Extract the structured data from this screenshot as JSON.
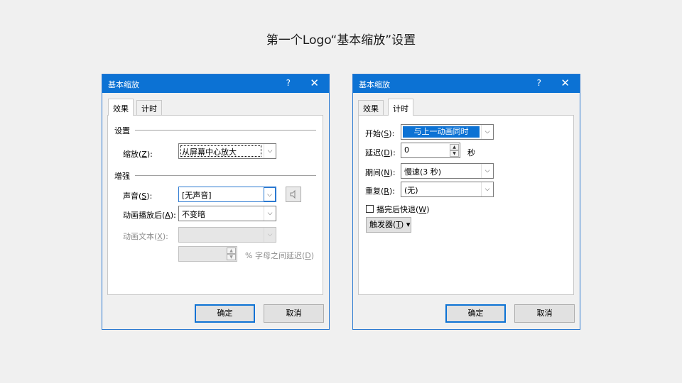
{
  "slide": {
    "title": "第一个Logo“基本缩放”设置"
  },
  "dialog_left": {
    "title": "基本缩放",
    "help": "?",
    "close": "✕",
    "tabs": [
      "效果",
      "计时"
    ],
    "section_settings": "设置",
    "zoom": {
      "label_pre": "缩放(",
      "key": "Z",
      "label_post": "):",
      "value": "从屏幕中心放大"
    },
    "section_enhance": "增强",
    "sound": {
      "label_pre": "声音(",
      "key": "S",
      "label_post": "):",
      "value": "[无声音]"
    },
    "after_anim": {
      "label_pre": "动画播放后(",
      "key": "A",
      "label_post": "):",
      "value": "不变暗"
    },
    "anim_text": {
      "label_pre": "动画文本(",
      "key": "X",
      "label_post": "):",
      "value": ""
    },
    "letter_delay": {
      "pre": "% 字母之间延迟(",
      "key": "D",
      "post": ")"
    },
    "ok": "确定",
    "cancel": "取消"
  },
  "dialog_right": {
    "title": "基本缩放",
    "help": "?",
    "close": "✕",
    "tabs": [
      "效果",
      "计时"
    ],
    "start": {
      "label_pre": "开始(",
      "key": "S",
      "label_post": "):",
      "value": "与上一动画同时"
    },
    "delay": {
      "label_pre": "延迟(",
      "key": "D",
      "label_post": "):",
      "value": "0",
      "unit": "秒"
    },
    "duration": {
      "label_pre": "期间(",
      "key": "N",
      "label_post": "):",
      "value": "慢速(3 秒)"
    },
    "repeat": {
      "label_pre": "重复(",
      "key": "R",
      "label_post": "):",
      "value": "(无)"
    },
    "rewind": {
      "label_pre": "播完后快退(",
      "key": "W",
      "label_post": ")"
    },
    "trigger": {
      "label_pre": "触发器(",
      "key": "T",
      "label_post": ")",
      "arrow": "▾"
    },
    "ok": "确定",
    "cancel": "取消"
  }
}
